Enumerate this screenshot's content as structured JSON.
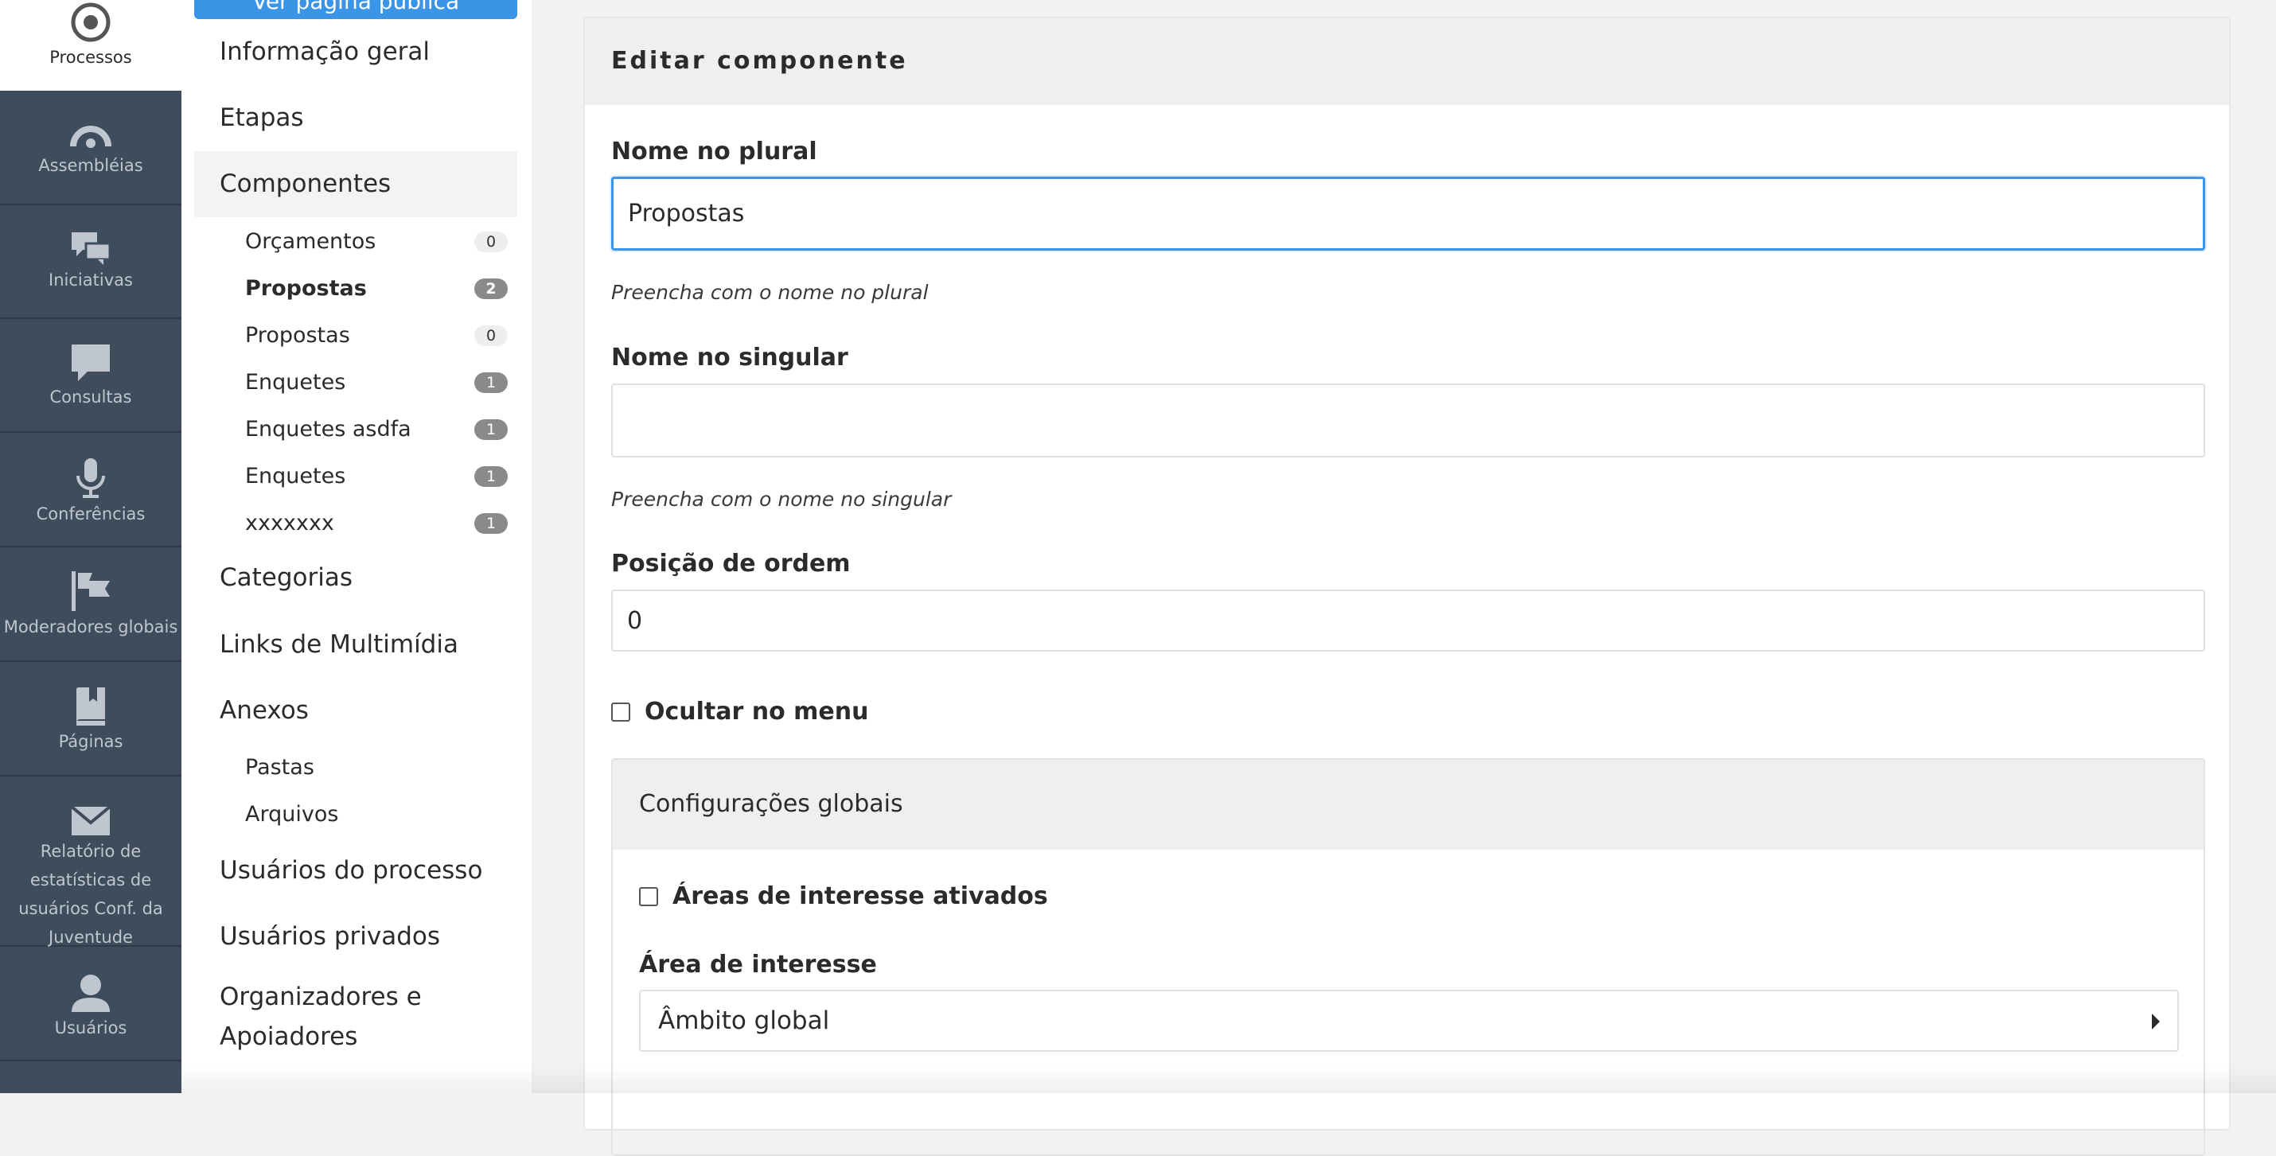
{
  "rail": {
    "items": [
      {
        "label": "Processos",
        "icon": "target-icon"
      },
      {
        "label": "Assembléias",
        "icon": "gauge-icon"
      },
      {
        "label": "Iniciativas",
        "icon": "chat-bubbles-icon"
      },
      {
        "label": "Consultas",
        "icon": "chat-bubble-icon"
      },
      {
        "label": "Conferências",
        "icon": "microphone-icon"
      },
      {
        "label": "Moderadores globais",
        "icon": "flag-icon"
      },
      {
        "label": "Páginas",
        "icon": "book-icon"
      },
      {
        "label": "Relatório de estatísticas de usuários Conf. da Juventude",
        "icon": "envelope-icon"
      },
      {
        "label": "Usuários",
        "icon": "user-icon"
      }
    ]
  },
  "submenu": {
    "public_page_button": "Ver página pública",
    "items": {
      "info": "Informação geral",
      "steps": "Etapas",
      "components": "Componentes",
      "categories": "Categorias",
      "media_links": "Links de Multimídia",
      "attachments": "Anexos",
      "process_users": "Usuários do processo",
      "private_users": "Usuários privados",
      "organizers": "Organizadores e Apoiadores"
    },
    "components": [
      {
        "label": "Orçamentos",
        "count": "0"
      },
      {
        "label": "Propostas",
        "count": "2"
      },
      {
        "label": "Propostas",
        "count": "0"
      },
      {
        "label": "Enquetes",
        "count": "1"
      },
      {
        "label": "Enquetes asdfa",
        "count": "1"
      },
      {
        "label": "Enquetes",
        "count": "1"
      },
      {
        "label": "xxxxxxx",
        "count": "1"
      }
    ],
    "attachments_sub": {
      "folders": "Pastas",
      "files": "Arquivos"
    }
  },
  "form": {
    "title": "Editar componente",
    "plural": {
      "label": "Nome no plural",
      "value": "Propostas",
      "help": "Preencha com o nome no plural"
    },
    "singular": {
      "label": "Nome no singular",
      "value": "",
      "help": "Preencha com o nome no singular"
    },
    "order": {
      "label": "Posição de ordem",
      "value": "0"
    },
    "hide_menu": {
      "label": "Ocultar no menu",
      "checked": false
    },
    "global_settings": {
      "title": "Configurações globais",
      "scopes_enabled": {
        "label": "Áreas de interesse ativados",
        "checked": false
      },
      "scope": {
        "label": "Área de interesse",
        "value": "Âmbito global"
      }
    }
  },
  "colors": {
    "rail_bg": "#3e4c5c",
    "accent": "#3a95e6",
    "badge_nonzero": "#8a8a8a"
  }
}
